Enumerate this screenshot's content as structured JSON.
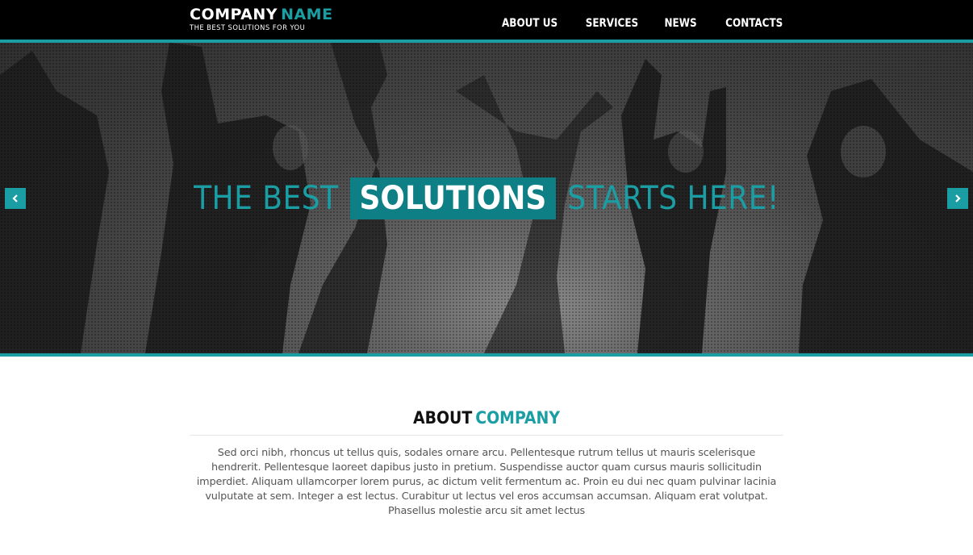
{
  "colors": {
    "accent": "#1a9ea4",
    "accent_dark": "#0e7f84",
    "header_bg": "#000000",
    "body_text": "#555555"
  },
  "header": {
    "logo_main": "COMPANY",
    "logo_accent": "NAME",
    "tagline": "THE BEST SOLUTIONS FOR YOU",
    "nav": [
      "ABOUT US",
      "SERVICES",
      "NEWS",
      "CONTACTS"
    ]
  },
  "hero": {
    "headline_pre": "THE BEST",
    "headline_highlight": "SOLUTIONS",
    "headline_post": "STARTS HERE!",
    "prev_icon": "chevron-left-icon",
    "next_icon": "chevron-right-icon"
  },
  "about": {
    "title_bold": "ABOUT",
    "title_accent": "COMPANY",
    "paragraph": "Sed orci nibh, rhoncus ut tellus quis, sodales ornare arcu. Pellentesque rutrum tellus ut mauris scelerisque hendrerit. Pellentesque laoreet dapibus justo in pretium. Suspendisse auctor quam cursus mauris sollicitudin imperdiet. Aliquam ullamcorper lorem purus, ac dictum velit fermentum ac. Proin eu dui nec quam pulvinar lacinia vulputate at sem. Integer a est lectus. Curabitur ut lectus vel eros accumsan accumsan. Aliquam erat volutpat. Phasellus molestie arcu sit amet lectus"
  }
}
